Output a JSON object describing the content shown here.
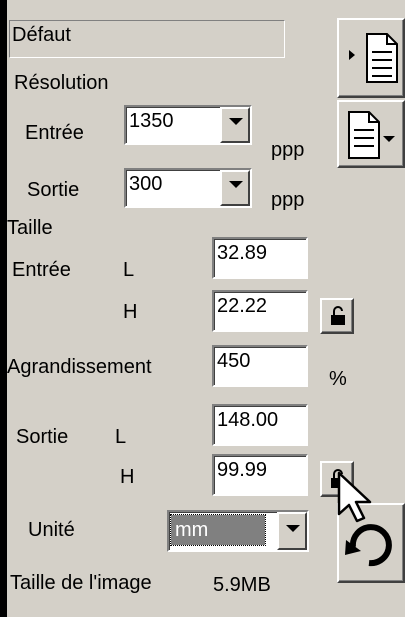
{
  "preset": {
    "value": "Défaut"
  },
  "resolution": {
    "heading": "Résolution",
    "input": {
      "label": "Entrée",
      "value": "1350",
      "unit": "ppp"
    },
    "output": {
      "label": "Sortie",
      "value": "300",
      "unit": "ppp"
    }
  },
  "size": {
    "heading": "Taille",
    "input": {
      "label": "Entrée",
      "width_label": "L",
      "width": "32.89",
      "height_label": "H",
      "height": "22.22"
    }
  },
  "enlargement": {
    "label": "Agrandissement",
    "value": "450",
    "unit": "%"
  },
  "output_size": {
    "label": "Sortie",
    "width_label": "L",
    "width": "148.00",
    "height_label": "H",
    "height": "99.99"
  },
  "unit": {
    "label": "Unité",
    "value": "mm"
  },
  "image_size": {
    "label": "Taille de l'image",
    "value": "5.9MB"
  },
  "icons": {
    "load_settings": "load-settings-icon",
    "save_settings": "save-settings-menu-icon",
    "lock": "padlock-icon",
    "reset": "undo-arrow-icon",
    "cursor": "mouse-pointer-icon"
  }
}
